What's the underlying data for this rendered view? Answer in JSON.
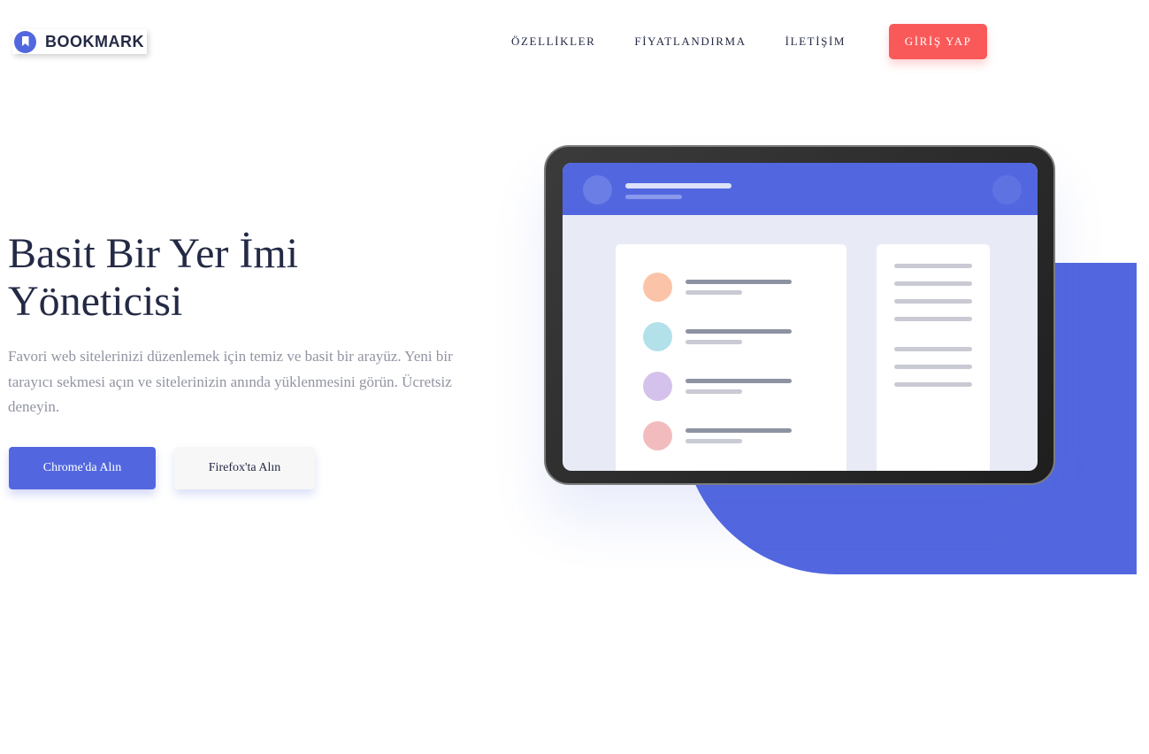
{
  "brand": {
    "name": "BOOKMARK",
    "color": "#5267df",
    "icon": "bookmark-icon"
  },
  "nav": {
    "links": [
      "ÖZELLİKLER",
      "FİYATLANDIRMA",
      "İLETİŞİM"
    ],
    "login_label": "GİRİŞ YAP",
    "login_color": "#fa5959"
  },
  "hero": {
    "title": "Basit Bir Yer İmi Yöneticisi",
    "description": "Favori web sitelerinizi düzenlemek için temiz ve basit bir arayüz. Yeni bir tarayıcı sekmesi açın ve sitelerinizin anında yüklenmesini görün. Ücretsiz deneyin.",
    "chrome_button": "Chrome'da Alın",
    "firefox_button": "Firefox'ta Alın"
  },
  "illustration": {
    "accent": "#5267df",
    "dot_colors": [
      "#fbc4a8",
      "#b2e1ea",
      "#d4c2ec",
      "#f2bcbf"
    ]
  }
}
